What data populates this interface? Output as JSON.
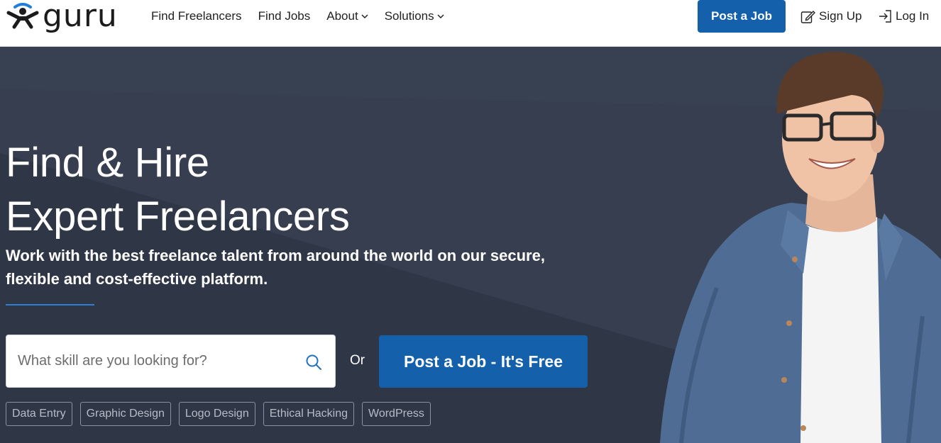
{
  "header": {
    "logo_text": "guru",
    "nav": [
      {
        "label": "Find Freelancers"
      },
      {
        "label": "Find Jobs"
      },
      {
        "label": "About"
      },
      {
        "label": "Solutions"
      }
    ],
    "post_job_label": "Post a Job",
    "sign_up_label": "Sign Up",
    "log_in_label": "Log In"
  },
  "hero": {
    "title_line1": "Find & Hire",
    "title_line2": "Expert Freelancers",
    "subtitle_line1": "Work with the best freelance talent from around the world on our secure,",
    "subtitle_line2": "flexible and cost-effective platform.",
    "search_placeholder": "What skill are you looking for?",
    "or_label": "Or",
    "post_job_label": "Post a Job - It's Free",
    "tags": [
      "Data Entry",
      "Graphic Design",
      "Logo Design",
      "Ethical Hacking",
      "WordPress"
    ]
  },
  "colors": {
    "brand_blue": "#1460aa",
    "hero_bg": "#363e4f",
    "accent_rule": "#2f7fd6"
  },
  "icons": {
    "logo": "guru-person-icon",
    "search": "search-icon",
    "sign_up": "edit-icon",
    "log_in": "login-icon",
    "dropdown": "chevron-down-icon"
  }
}
